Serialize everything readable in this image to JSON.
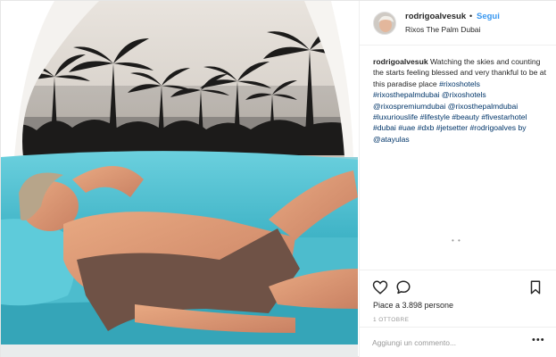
{
  "post": {
    "photo_alt": "photo",
    "header": {
      "username": "rodrigoalvesuk",
      "separator": "•",
      "follow_label": "Segui",
      "location": "Rixos The Palm Dubai",
      "avatar_icon": "profile-avatar"
    },
    "caption": {
      "username": "rodrigoalvesuk",
      "text": "Watching the skies and counting the starts feeling blessed and very thankful to be at this paradise place",
      "hashtags_line1": "#rixoshotels #rixosthepalmdubai",
      "hashtags_line2": "@rixoshotels @rixospremiumdubai",
      "hashtags_line3": "@rixosthepalmdubai #luxuriouslife",
      "hashtags_line4": "#lifestyle #beauty #fivestarhotel #dubai",
      "hashtags_line5": "#uae #dxb #jetsetter #rodrigoalves by",
      "hashtags_line6": "@atayulas"
    },
    "load_more": "• •",
    "actions": {
      "like_icon": "heart-icon",
      "comment_icon": "comment-icon",
      "save_icon": "bookmark-icon"
    },
    "likes_text": "Piace a 3.898 persone",
    "date_text": "1 OTTOBRE",
    "comment": {
      "placeholder": "Aggiungi un commento...",
      "more_label": "•••"
    }
  },
  "colors": {
    "link_blue": "#3897f0",
    "hashtag_blue": "#003569",
    "text": "#262626",
    "muted": "#999999",
    "sofa_turquoise": "#56c2d2"
  }
}
